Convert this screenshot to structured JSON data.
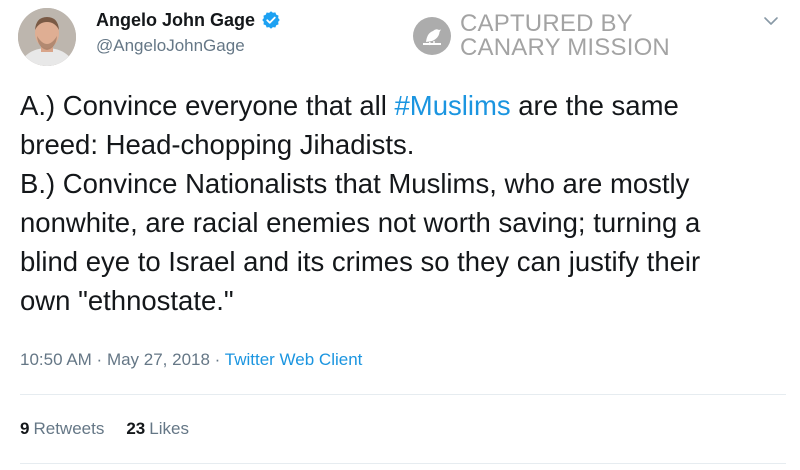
{
  "author": {
    "name": "Angelo John Gage",
    "handle": "@AngeloJohnGage",
    "verified": true
  },
  "watermark": {
    "line1": "CAPTURED BY",
    "line2": "CANARY MISSION"
  },
  "tweet": {
    "lines": [
      {
        "before": "A.) Convince everyone that all ",
        "hashtag": "#Muslims",
        "after": " are the same"
      },
      {
        "text": "breed: Head-chopping Jihadists."
      },
      {
        "text": "B.) Convince Nationalists that Muslims, who are mostly"
      },
      {
        "text": "nonwhite, are racial enemies not worth saving; turning a"
      },
      {
        "text": "blind eye to Israel and its crimes so they can justify their"
      },
      {
        "text": "own \"ethnostate.\""
      }
    ]
  },
  "meta": {
    "time": "10:50 AM",
    "separator": " · ",
    "date": "May 27, 2018",
    "source": "Twitter Web Client"
  },
  "stats": {
    "retweets_count": "9",
    "retweets_label": "Retweets",
    "likes_count": "23",
    "likes_label": "Likes"
  },
  "colors": {
    "link": "#1b95e0",
    "verified": "#1da1f2",
    "secondary_text": "#657786"
  },
  "icons": {
    "verified": "verified-badge-icon",
    "caret": "chevron-down-icon",
    "watermark": "canary-logo-icon"
  }
}
